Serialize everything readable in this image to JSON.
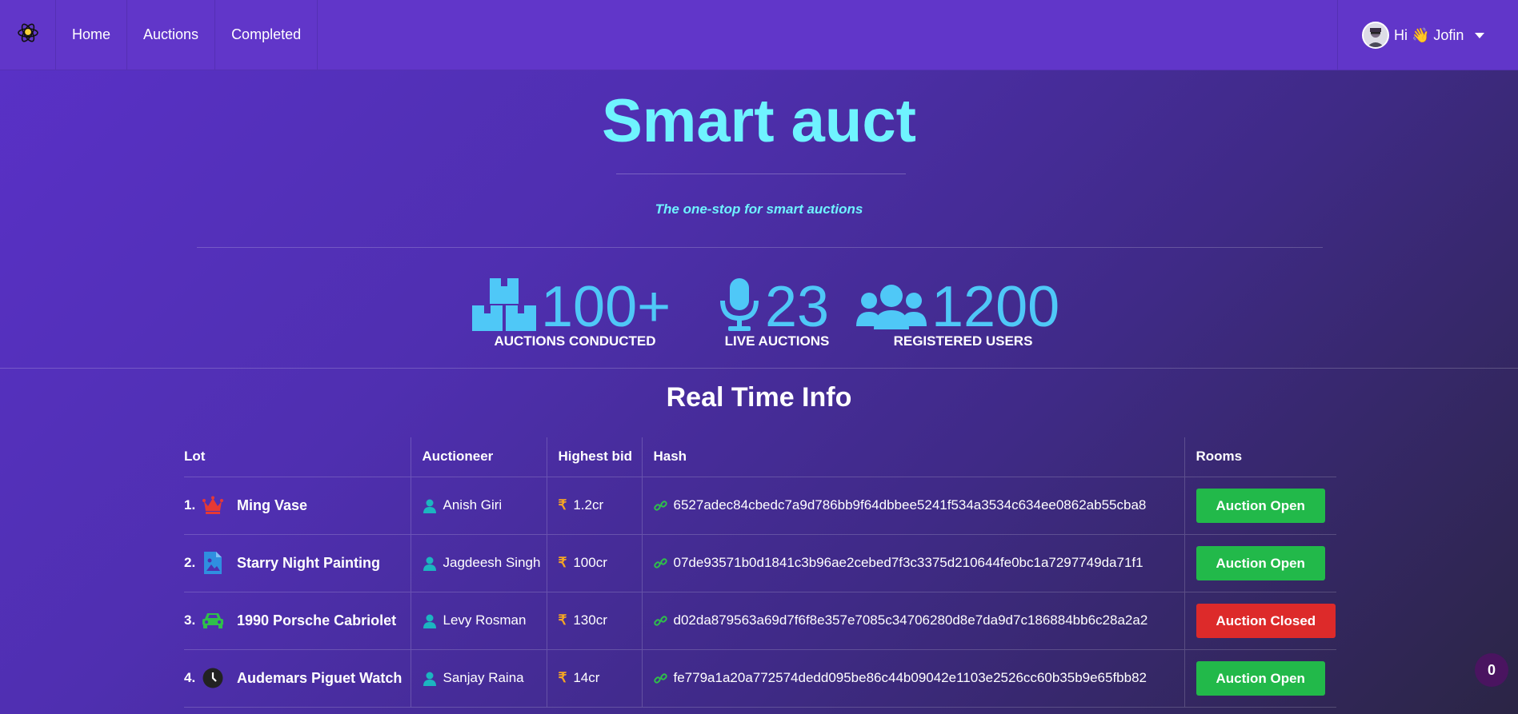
{
  "nav": {
    "brand_icon": "atom-bulb-icon",
    "items": [
      "Home",
      "Auctions",
      "Completed"
    ],
    "user_greeting": "Hi 👋 Jofin"
  },
  "hero": {
    "title": "Smart auct",
    "tagline": "The one-stop for smart auctions"
  },
  "stats": [
    {
      "icon": "boxes-icon",
      "value": "100+",
      "label": "AUCTIONS CONDUCTED"
    },
    {
      "icon": "microphone-icon",
      "value": "23",
      "label": "LIVE AUCTIONS"
    },
    {
      "icon": "users-icon",
      "value": "1200",
      "label": "REGISTERED USERS"
    }
  ],
  "section_title": "Real Time Info",
  "table": {
    "headers": [
      "Lot",
      "Auctioneer",
      "Highest bid",
      "Hash",
      "Rooms"
    ],
    "rows": [
      {
        "num": "1.",
        "icon": "crown-icon",
        "icon_color": "#e53935",
        "lot": "Ming Vase",
        "auctioneer": "Anish Giri",
        "bid": "1.2cr",
        "hash": "6527adec84cbedc7a9d786bb9f64dbbee5241f534a3534c634ee0862ab55cba8",
        "room": "Auction Open",
        "status": "open"
      },
      {
        "num": "2.",
        "icon": "image-file-icon",
        "icon_color": "#2f8fe0",
        "lot": "Starry Night Painting",
        "auctioneer": "Jagdeesh Singh",
        "bid": "100cr",
        "hash": "07de93571b0d1841c3b96ae2cebed7f3c3375d210644fe0bc1a7297749da71f1",
        "room": "Auction Open",
        "status": "open"
      },
      {
        "num": "3.",
        "icon": "car-icon",
        "icon_color": "#2fbf4a",
        "lot": "1990 Porsche Cabriolet",
        "auctioneer": "Levy Rosman",
        "bid": "130cr",
        "hash": "d02da879563a69d7f6f8e357e7085c34706280d8e7da9d7c186884bb6c28a2a2",
        "room": "Auction Closed",
        "status": "closed"
      },
      {
        "num": "4.",
        "icon": "clock-icon",
        "icon_color": "#222222",
        "lot": "Audemars Piguet Watch",
        "auctioneer": "Sanjay Raina",
        "bid": "14cr",
        "hash": "fe779a1a20a772574dedd095be86c44b09042e1103e2526cc60b35b9e65fbb82",
        "room": "Auction Open",
        "status": "open"
      }
    ]
  },
  "notification_count": "0",
  "colors": {
    "nav_bg": "#6136c9",
    "accent_cyan": "#6ff3ff",
    "stat_blue": "#4fc8f7",
    "open_green": "#22b94a",
    "closed_red": "#dd2a2a",
    "user_icon_teal": "#1cb5c0",
    "rupee_orange": "#f5a623",
    "link_green": "#2fbf4a"
  }
}
